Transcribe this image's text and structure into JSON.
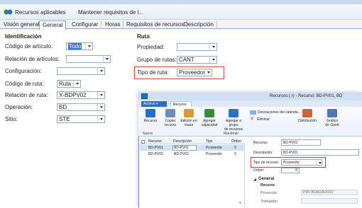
{
  "top": {
    "actions": [
      "Recursos aplicables",
      "Mantener requisitos de l..."
    ],
    "tabs": [
      "Visión general",
      "General",
      "Configurar",
      "Horas",
      "Requisitos de recursos",
      "Descripción"
    ],
    "active_tab": "General"
  },
  "identificacion": {
    "title": "Identificación",
    "fields": [
      {
        "label": "Código de artículo:",
        "value": "Todo"
      },
      {
        "label": "Relación de artículos:",
        "value": ""
      },
      {
        "label": "Configuración:",
        "value": ""
      },
      {
        "label": "Código de ruta:",
        "value": "Ruta"
      },
      {
        "label": "Relación de ruta:",
        "value": "X-BDPV02"
      },
      {
        "label": "Operación:",
        "value": "BD"
      },
      {
        "label": "Sitio:",
        "value": "STE"
      }
    ]
  },
  "ruta": {
    "title": "Ruta",
    "fields": [
      {
        "label": "Propiedad:",
        "value": ""
      },
      {
        "label": "Grupo de rutas:",
        "value": "CANT"
      },
      {
        "label": "Tipo de ruta:",
        "value": "Proveedor"
      }
    ]
  },
  "inner": {
    "title": "Recursos (     r) - Recurso: BD-PV01, BD",
    "ribbon_tabs": [
      "Archivo",
      "Recurso"
    ],
    "groups": [
      "Nuevo",
      "Mantener"
    ],
    "buttons": [
      {
        "label": "Recurso",
        "sub": ""
      },
      {
        "label": "Copiar",
        "sub": "recurso"
      },
      {
        "label": "Edición en",
        "sub": "masa"
      },
      {
        "label": "Agregar",
        "sub": "capacidad"
      },
      {
        "label": "Agregar a grupo",
        "sub": "de recursos"
      },
      {
        "label": "Distribución",
        "sub": ""
      },
      {
        "label": "Gráfico",
        "sub": "de Gantt"
      }
    ],
    "small_actions": [
      "Desviaciones del calenda...",
      "Eliminar"
    ],
    "columns": [
      "Recurso",
      "Descripción",
      "Tipo",
      "Orden"
    ],
    "rows": [
      {
        "recurso": "BD-PV01",
        "descripcion": "BD-PV01",
        "tipo": "Proveedor",
        "orden": "0"
      },
      {
        "recurso": "BD-PV02",
        "descripcion": "BD-PV02",
        "tipo": "Proveedor",
        "orden": "0"
      }
    ],
    "detail": {
      "recurso_label": "Recurso:",
      "recurso": "BD-PV01",
      "descripcion_label": "Descripción:",
      "descripcion": "BD-PV01",
      "tipo_label": "Tipo de recurso:",
      "tipo": "Proveedor",
      "orden_label": "Orden:",
      "orden": "0",
      "general": "General",
      "recurso_sub": "Recurso",
      "proveedor_label": "Proveedor:",
      "proveedor": "PRV-BORDADO01",
      "trabajador_label": "Trabajador:"
    }
  },
  "colors": {
    "highlight": "#e0303c",
    "accent": "#1e63b0",
    "ribbon_tab": "#2b6cc4"
  }
}
